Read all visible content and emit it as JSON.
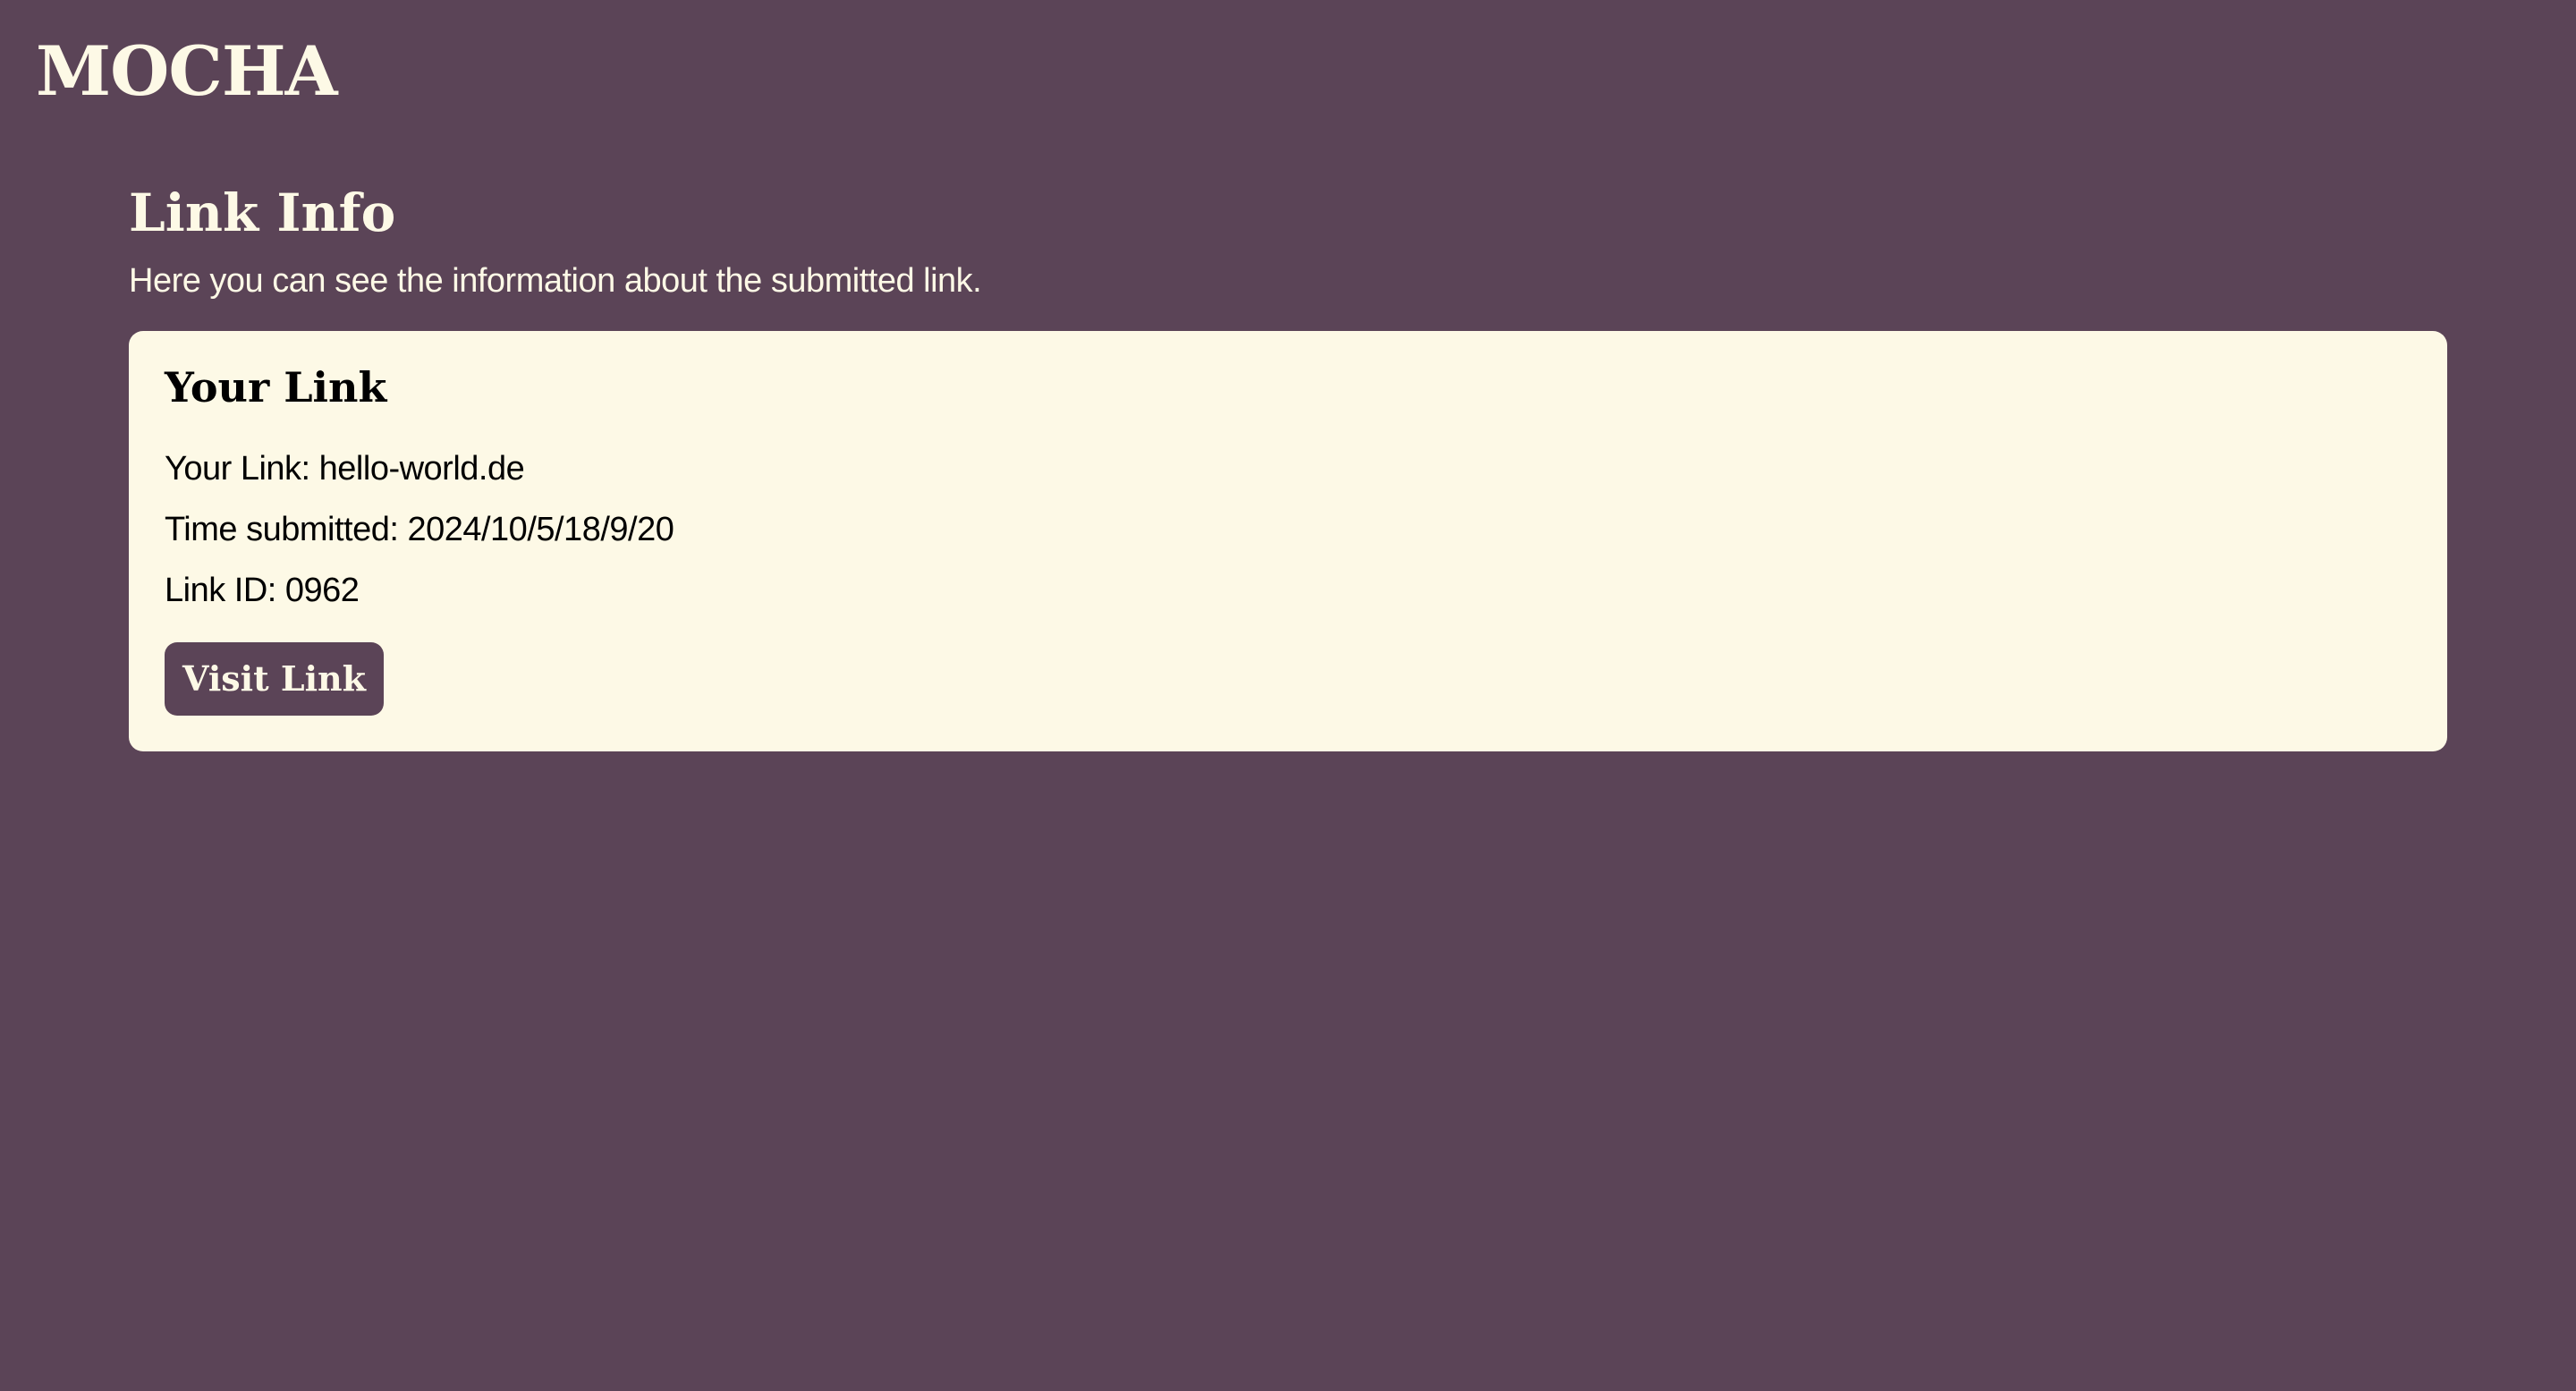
{
  "header": {
    "logo_text": "MOCHA"
  },
  "page": {
    "title": "Link Info",
    "subtitle": "Here you can see the information about the submitted link."
  },
  "card": {
    "title": "Your Link",
    "link_line": "Your Link: hello-world.de",
    "time_line": "Time submitted: 2024/10/5/18/9/20",
    "id_line": "Link ID: 0962",
    "button_label": "Visit Link"
  },
  "colors": {
    "background": "#5b4457",
    "card_background": "#fdf9e6",
    "accent": "#5b4457"
  }
}
